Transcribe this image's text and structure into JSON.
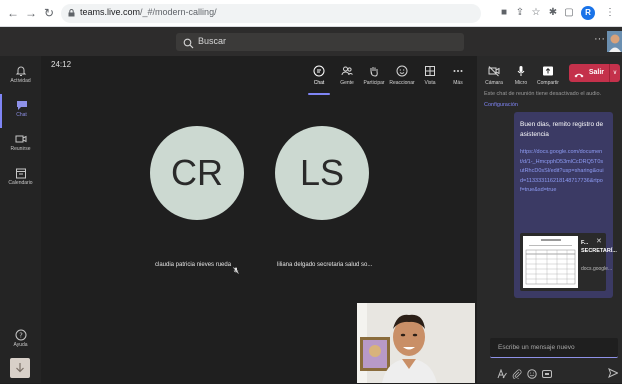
{
  "browser": {
    "url_host": "teams.live.com",
    "url_path": "/_#/modern-calling/",
    "profile_initial": "R"
  },
  "topbar": {
    "search_placeholder": "Buscar",
    "more": "···"
  },
  "rail": {
    "items": [
      {
        "label": "Actividad",
        "icon": "bell-icon"
      },
      {
        "label": "Chat",
        "icon": "chat-icon"
      },
      {
        "label": "Reunirse",
        "icon": "video-icon"
      },
      {
        "label": "Calendario",
        "icon": "calendar-icon"
      }
    ],
    "help_label": "Ayuda"
  },
  "meeting": {
    "timer": "24:12",
    "controls": [
      {
        "label": "Chat",
        "icon": "chat-icon"
      },
      {
        "label": "Gente",
        "icon": "people-icon"
      },
      {
        "label": "Participar",
        "icon": "hand-icon"
      },
      {
        "label": "Reaccionar",
        "icon": "smile-icon"
      },
      {
        "label": "Vista",
        "icon": "grid-icon"
      },
      {
        "label": "Más",
        "icon": "more-icon"
      }
    ],
    "participants": [
      {
        "initials": "CR",
        "name": "claudia patricia nieves rueda"
      },
      {
        "initials": "LS",
        "name": "liliana delgado secretaria salud so..."
      }
    ]
  },
  "call_controls": {
    "camera": "Cámara",
    "mic": "Micro",
    "share": "Compartir",
    "leave": "Salir"
  },
  "chat": {
    "notice": "Este chat de reunión tiene desactivado el audio.",
    "notice_link": "Configuración",
    "message_title": "Buen dias, remito registro de asistencia",
    "message_url": "https://docs.google.com/document/d/1-_HmcpphD53mlCcDRQ5T0sutRhcD0sSl/edit?usp=sharing&ouid=113333116218148717736&rtpof=true&sd=true",
    "attachment_name": "F... SECRETARÍ...",
    "attachment_source": "docs.google...",
    "compose_placeholder": "Escribe un mensaje nuevo"
  },
  "colors": {
    "accent": "#7f85f5",
    "leave": "#c4314b",
    "avatar_bg": "#ccd9d1",
    "message_bg": "#3b3a64"
  }
}
